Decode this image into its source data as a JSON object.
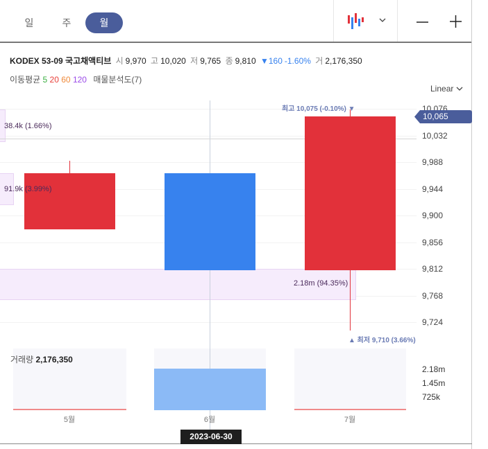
{
  "tabs": [
    {
      "label": "일"
    },
    {
      "label": "주"
    },
    {
      "label": "월",
      "active": true
    }
  ],
  "toolbar": {
    "chart_type_icon": "candlestick-icon",
    "dropdown_icon": "chevron-down-icon",
    "zoom_out": "—",
    "zoom_in": "+"
  },
  "info": {
    "name": "KODEX 53-09 국고채액티브",
    "open_label": "시",
    "open": "9,970",
    "high_label": "고",
    "high": "10,020",
    "low_label": "저",
    "low": "9,765",
    "close_label": "종",
    "close": "9,810",
    "change": "▼160",
    "change_pct": "-1.60%",
    "volume_label": "거",
    "volume": "2,176,350"
  },
  "indicators": {
    "ma_label": "이동평균",
    "ma": [
      "5",
      "20",
      "60",
      "120"
    ],
    "ma_colors": [
      "#3cb043",
      "#e8403a",
      "#f08a3a",
      "#9b4be8"
    ],
    "profile": "매물분석도(7)"
  },
  "scale": {
    "label": "Linear"
  },
  "colors": {
    "up": "#e2313a",
    "down": "#3782ee",
    "accent": "#4a5d9b"
  },
  "chart_data": {
    "type": "candlestick",
    "categories": [
      "5월",
      "6월",
      "7월"
    ],
    "candles": [
      {
        "open": 9877,
        "high": 9990,
        "low": 9877,
        "close": 9970,
        "volume": 20000
      },
      {
        "open": 9970,
        "high": 9970,
        "low": 9810,
        "close": 9810,
        "volume": 2176350
      },
      {
        "open": 9810,
        "high": 10075,
        "low": 9710,
        "close": 10063,
        "volume": 20000
      }
    ],
    "yticks": [
      "10,076",
      "10,032",
      "9,988",
      "9,944",
      "9,900",
      "9,856",
      "9,812",
      "9,768",
      "9,724"
    ],
    "ylim": [
      9724,
      10076
    ],
    "current_price": "10,065",
    "high_note": "최고 10,075 (-0.10%) ▼",
    "low_note": "▲ 최저 9,710 (3.66%)",
    "profile": [
      {
        "label": "38.4k (1.66%)"
      },
      {
        "label": "91.9k (3.99%)"
      },
      {
        "label": "2.18m (94.35%)"
      }
    ],
    "volume_label": "거래량",
    "volume_value": "2,176,350",
    "volume_ticks": [
      "2.18m",
      "1.45m",
      "725k"
    ],
    "crosshair_date": "2023-06-30"
  }
}
